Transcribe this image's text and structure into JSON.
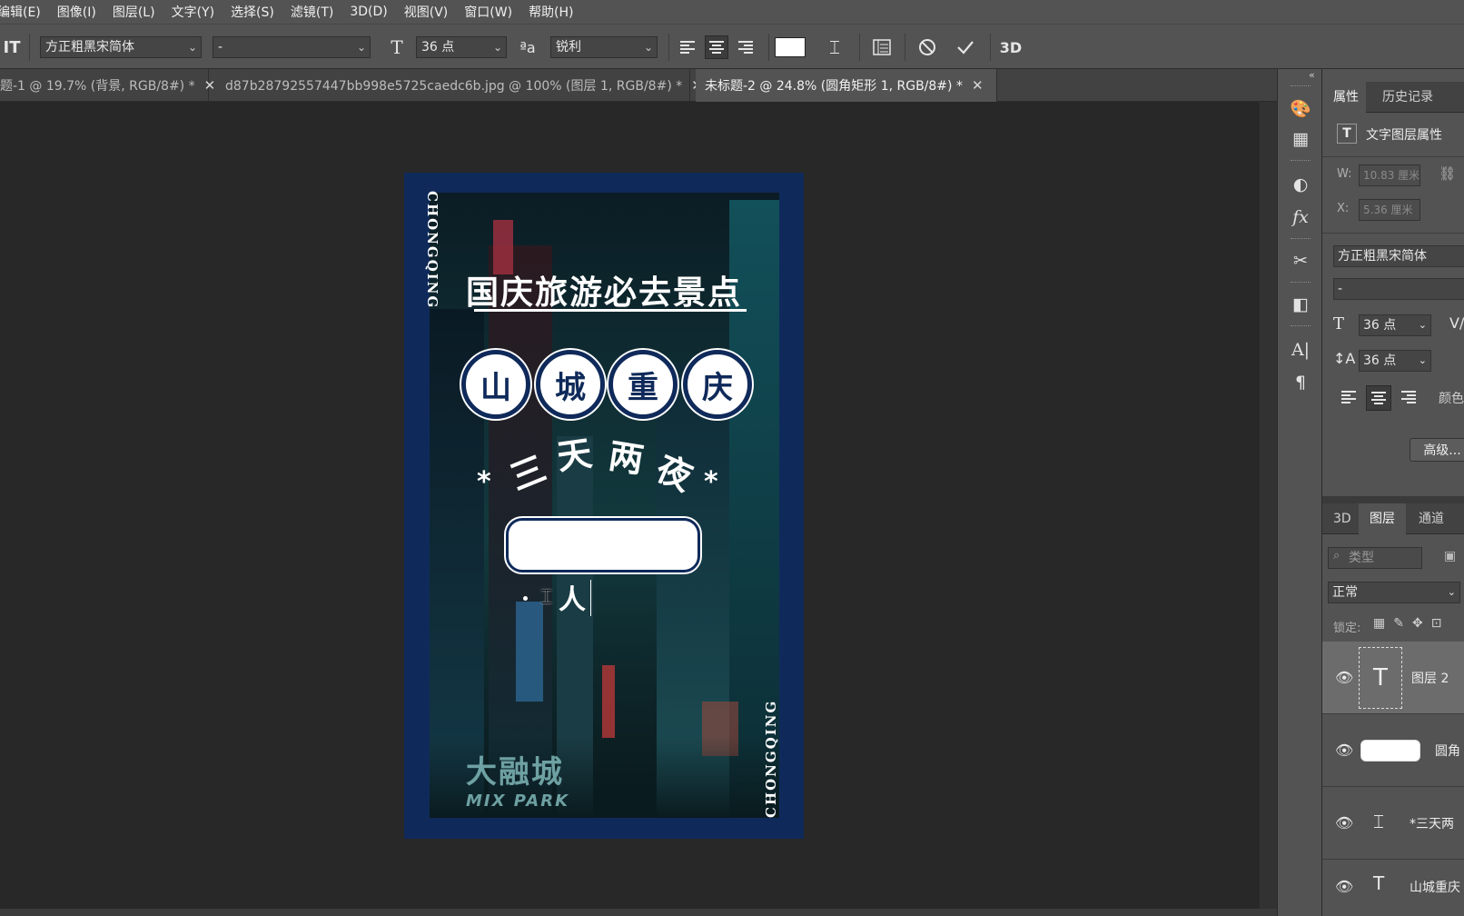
{
  "menu": [
    "编辑(E)",
    "图像(I)",
    "图层(L)",
    "文字(Y)",
    "选择(S)",
    "滤镜(T)",
    "3D(D)",
    "视图(V)",
    "窗口(W)",
    "帮助(H)"
  ],
  "options": {
    "font_family": "方正粗黑宋简体",
    "font_style": "-",
    "font_size": "36 点",
    "antialias": "锐利",
    "threeD": "3D"
  },
  "tabs": [
    {
      "label": "题-1 @ 19.7% (背景, RGB/8#) *"
    },
    {
      "label": "d87b28792557447bb998e5725caedc6b.jpg  @  100% (图层 1, RGB/8#) *"
    },
    {
      "label": "未标题-2 @ 24.8% (圆角矩形 1, RGB/8#) *"
    }
  ],
  "poster": {
    "side_text_left": "CHONGQING",
    "side_text_right": "CHONGQING",
    "title": "国庆旅游必去景点",
    "circles": [
      "山",
      "城",
      "重",
      "庆"
    ],
    "arc_text": [
      "三",
      "天",
      "两",
      "夜"
    ],
    "star": "*",
    "caret_text": "人",
    "mall_cn": "大融城",
    "mall_en": "MIX PARK"
  },
  "panel": {
    "tabs": [
      "属性",
      "历史记录"
    ],
    "props_header": "文字图层属性",
    "w_label": "W:",
    "w_value": "10.83 厘米",
    "x_label": "X:",
    "x_value": "5.36 厘米",
    "font": "方正粗黑宋简体",
    "style": "-",
    "size": "36 点",
    "leading": "36 点",
    "color_label": "颜色",
    "advanced": "高级..."
  },
  "layers_panel": {
    "tabs": [
      "3D",
      "图层",
      "通道"
    ],
    "search": "类型",
    "blend": "正常",
    "lock_label": "锁定:",
    "layers": [
      {
        "name": "图层 2",
        "kind": "T",
        "selected": true
      },
      {
        "name": "圆角",
        "kind": "rect",
        "selected": false
      },
      {
        "name": "*三天两",
        "kind": "warp",
        "selected": false
      },
      {
        "name": "山城重庆",
        "kind": "T",
        "selected": false
      }
    ]
  },
  "colors": {
    "poster_navy": "#0f2a5a",
    "ui_dark": "#535353",
    "canvas_bg": "#282828"
  }
}
